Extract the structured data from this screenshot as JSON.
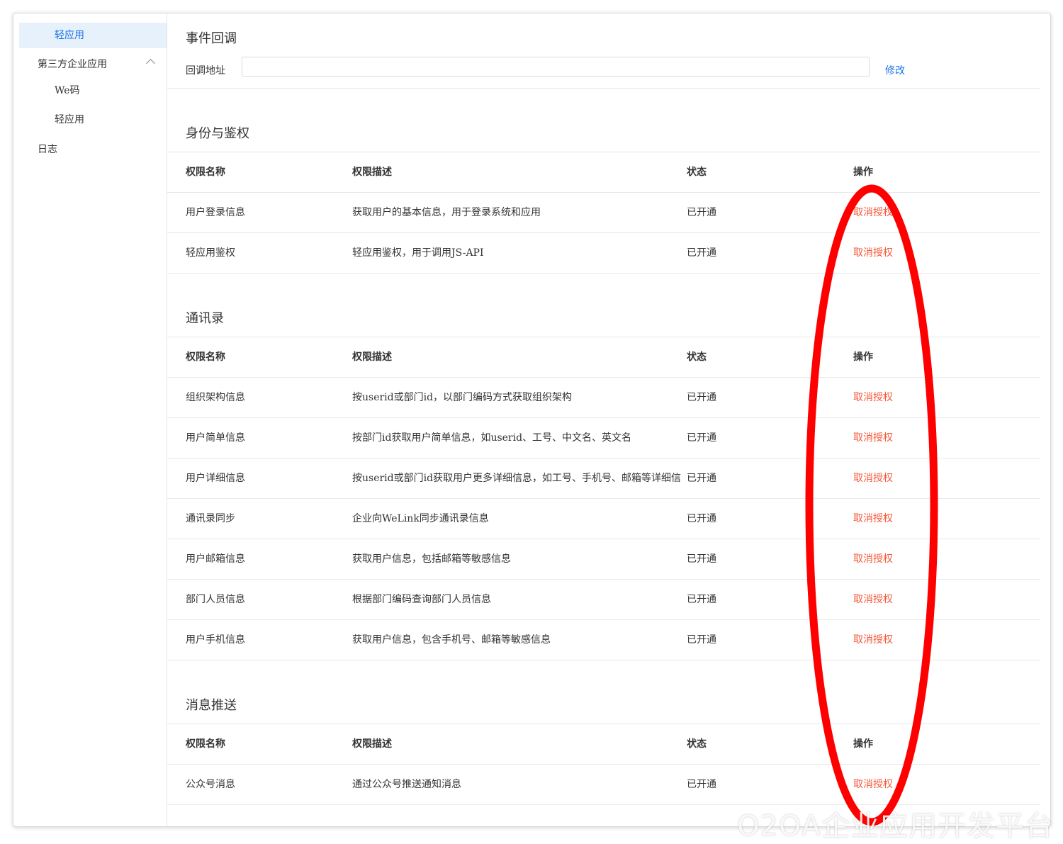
{
  "sidebar": {
    "items": [
      {
        "label": "轻应用"
      },
      {
        "label": "第三方企业应用"
      },
      {
        "label": "We码"
      },
      {
        "label": "轻应用"
      },
      {
        "label": "日志"
      }
    ]
  },
  "callback": {
    "title": "事件回调",
    "label": "回调地址",
    "value": "",
    "link": "修改"
  },
  "table_headers": {
    "name": "权限名称",
    "desc": "权限描述",
    "status": "状态",
    "action": "操作"
  },
  "sections": [
    {
      "title": "身份与鉴权",
      "rows": [
        {
          "name": "用户登录信息",
          "desc": "获取用户的基本信息，用于登录系统和应用",
          "status": "已开通",
          "action": "取消授权"
        },
        {
          "name": "轻应用鉴权",
          "desc": "轻应用鉴权，用于调用JS-API",
          "status": "已开通",
          "action": "取消授权"
        }
      ]
    },
    {
      "title": "通讯录",
      "rows": [
        {
          "name": "组织架构信息",
          "desc": "按userid或部门id，以部门编码方式获取组织架构",
          "status": "已开通",
          "action": "取消授权"
        },
        {
          "name": "用户简单信息",
          "desc": "按部门id获取用户简单信息，如userid、工号、中文名、英文名",
          "status": "已开通",
          "action": "取消授权"
        },
        {
          "name": "用户详细信息",
          "desc": "按userid或部门id获取用户更多详细信息，如工号、手机号、邮箱等详细信",
          "status": "已开通",
          "action": "取消授权"
        },
        {
          "name": "通讯录同步",
          "desc": "企业向WeLink同步通讯录信息",
          "status": "已开通",
          "action": "取消授权"
        },
        {
          "name": "用户邮箱信息",
          "desc": "获取用户信息，包括邮箱等敏感信息",
          "status": "已开通",
          "action": "取消授权"
        },
        {
          "name": "部门人员信息",
          "desc": "根据部门编码查询部门人员信息",
          "status": "已开通",
          "action": "取消授权"
        },
        {
          "name": "用户手机信息",
          "desc": "获取用户信息，包含手机号、邮箱等敏感信息",
          "status": "已开通",
          "action": "取消授权"
        }
      ]
    },
    {
      "title": "消息推送",
      "rows": [
        {
          "name": "公众号消息",
          "desc": "通过公众号推送通知消息",
          "status": "已开通",
          "action": "取消授权"
        }
      ]
    }
  ],
  "watermark": "O2OA企业应用开发平台",
  "colors": {
    "accent": "#1a73e8",
    "revoke": "#f5593b",
    "annotation": "#ff0000"
  }
}
